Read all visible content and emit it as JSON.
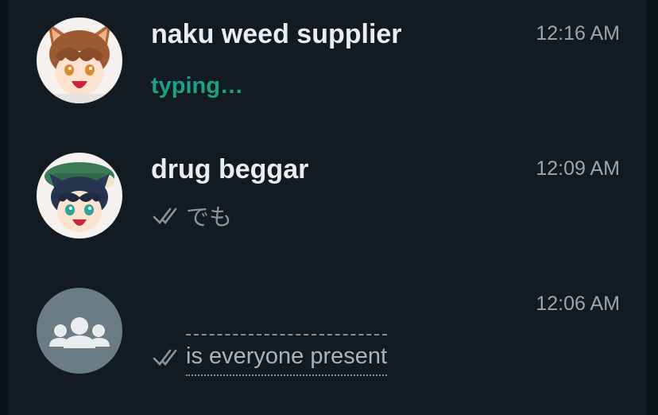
{
  "chats": [
    {
      "name": "naku weed supplier",
      "time": "12:16 AM",
      "preview": "typing…",
      "status": "typing",
      "avatar": "anime-character-fox-ears-avatar"
    },
    {
      "name": "drug beggar",
      "time": "12:09 AM",
      "preview": "でも",
      "status": "read",
      "avatar": "anime-character-green-hat-avatar"
    },
    {
      "name": "",
      "time": "12:06 AM",
      "preview": "is everyone present",
      "status": "read",
      "avatar": "group-icon"
    }
  ],
  "colors": {
    "background": "#121b22",
    "typing_accent": "#1ca186",
    "group_avatar_bg": "#6b7c85"
  }
}
